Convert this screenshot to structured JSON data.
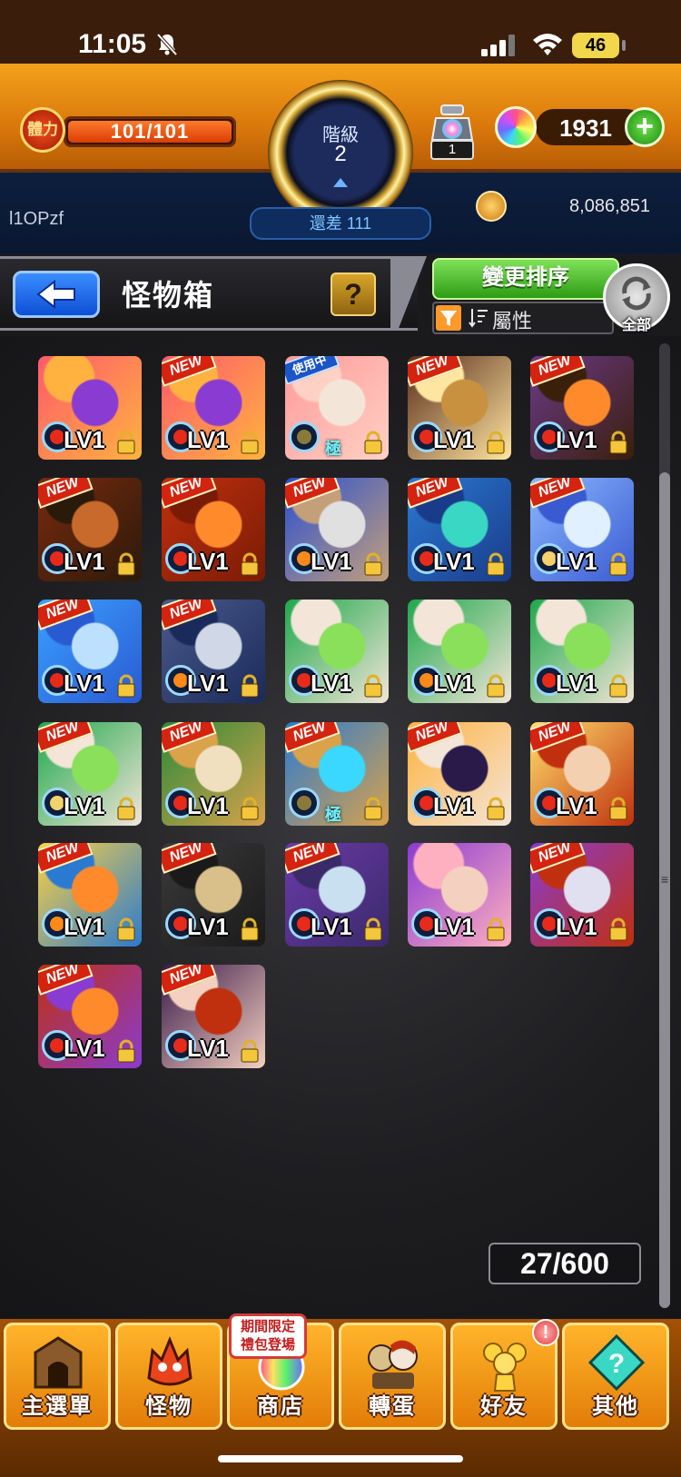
{
  "status_bar": {
    "time": "11:05",
    "battery": "46",
    "icons": [
      "bell-slash-icon",
      "signal-icon",
      "wifi-icon",
      "battery-icon"
    ]
  },
  "hud": {
    "stamina_label": "體力",
    "stamina_value": "101/101",
    "rank_label": "階級",
    "rank_value": "2",
    "rank_remaining": "還差 111",
    "potion_count": "1",
    "orb_count": "1931",
    "plus_label": "+",
    "username": "l1OPzf",
    "gold": "8,086,851"
  },
  "header": {
    "title": "怪物箱",
    "help_label": "?",
    "sort_button": "變更排序",
    "sort_attribute": "屬性",
    "all_label": "全部"
  },
  "monsters": [
    {
      "badge": "",
      "lv": "LV1",
      "element": "fire",
      "art": [
        "#ff5a6b",
        "#8a3bd1",
        "#ffb23f"
      ]
    },
    {
      "badge": "NEW",
      "lv": "LV1",
      "element": "fire",
      "art": [
        "#ff5a6b",
        "#8a3bd1",
        "#ffb23f"
      ]
    },
    {
      "badge": "使用中",
      "lv": "",
      "element": "dark",
      "art": [
        "#ff9a9a",
        "#f3e5d8",
        "#ffd0c4"
      ],
      "tag": "極"
    },
    {
      "badge": "NEW",
      "lv": "LV1",
      "element": "fire",
      "art": [
        "#5a2d1c",
        "#c8913f",
        "#ffe6a0"
      ]
    },
    {
      "badge": "NEW",
      "lv": "LV1",
      "element": "fire",
      "art": [
        "#6b3a8a",
        "#ff8a2b",
        "#3a1f0a"
      ]
    },
    {
      "badge": "NEW",
      "lv": "LV1",
      "element": "fire",
      "art": [
        "#7a2a0e",
        "#c86a2b",
        "#2a1a0a"
      ]
    },
    {
      "badge": "NEW",
      "lv": "LV1",
      "element": "fire",
      "art": [
        "#c0300e",
        "#ff8a2b",
        "#7a1b05"
      ]
    },
    {
      "badge": "NEW",
      "lv": "LV1",
      "element": "flame",
      "art": [
        "#2a4fd1",
        "#e0e0e0",
        "#c4a07a"
      ]
    },
    {
      "badge": "NEW",
      "lv": "LV1",
      "element": "fire",
      "art": [
        "#2a7ad1",
        "#3ad7c4",
        "#1a3b8a"
      ]
    },
    {
      "badge": "NEW",
      "lv": "LV1",
      "element": "light",
      "art": [
        "#8ab8ff",
        "#e0f0ff",
        "#3a5ad1"
      ]
    },
    {
      "badge": "NEW",
      "lv": "LV1",
      "element": "fire",
      "art": [
        "#3aa0ff",
        "#bde0ff",
        "#2a5ad1"
      ]
    },
    {
      "badge": "NEW",
      "lv": "LV1",
      "element": "flame",
      "art": [
        "#4a5a8a",
        "#d0d8e8",
        "#1a2a5a"
      ]
    },
    {
      "badge": "",
      "lv": "LV1",
      "element": "fire",
      "art": [
        "#1ea84b",
        "#8ae05a",
        "#f3e5d8"
      ]
    },
    {
      "badge": "",
      "lv": "LV1",
      "element": "flame",
      "art": [
        "#1ea84b",
        "#8ae05a",
        "#f3e5d8"
      ]
    },
    {
      "badge": "",
      "lv": "LV1",
      "element": "fire",
      "art": [
        "#1ea84b",
        "#8ae05a",
        "#f3e5d8"
      ]
    },
    {
      "badge": "NEW",
      "lv": "LV1",
      "element": "light",
      "art": [
        "#1ea84b",
        "#8ae05a",
        "#f3e5d8"
      ]
    },
    {
      "badge": "NEW",
      "lv": "LV1",
      "element": "fire",
      "art": [
        "#2a8a3a",
        "#f0e0c0",
        "#d9a24b"
      ]
    },
    {
      "badge": "NEW",
      "lv": "",
      "element": "dark",
      "art": [
        "#2a7ad1",
        "#3ad7ff",
        "#d9a24b"
      ],
      "tag": "極"
    },
    {
      "badge": "NEW",
      "lv": "LV1",
      "element": "fire",
      "art": [
        "#ffb23f",
        "#2a1a4a",
        "#f3e5d8"
      ]
    },
    {
      "badge": "NEW",
      "lv": "LV1",
      "element": "fire",
      "art": [
        "#ffe06b",
        "#f3d0b0",
        "#c0300e"
      ]
    },
    {
      "badge": "NEW",
      "lv": "LV1",
      "element": "flame",
      "art": [
        "#ffd23f",
        "#ff8a2b",
        "#2a7ad1"
      ]
    },
    {
      "badge": "NEW",
      "lv": "LV1",
      "element": "fire",
      "art": [
        "#3a3a3a",
        "#d9c08a",
        "#1a1a1a"
      ]
    },
    {
      "badge": "NEW",
      "lv": "LV1",
      "element": "fire",
      "art": [
        "#6b3aa8",
        "#c8e0f0",
        "#3a2a6a"
      ]
    },
    {
      "badge": "",
      "lv": "LV1",
      "element": "fire",
      "art": [
        "#8a3bd1",
        "#f3d0c0",
        "#ffb0c0"
      ]
    },
    {
      "badge": "NEW",
      "lv": "LV1",
      "element": "fire",
      "art": [
        "#8a3bd1",
        "#e0e0f0",
        "#c0300e"
      ]
    },
    {
      "badge": "NEW",
      "lv": "LV1",
      "element": "fire",
      "art": [
        "#c0300e",
        "#ff8a2b",
        "#8a3bd1"
      ]
    },
    {
      "badge": "NEW",
      "lv": "LV1",
      "element": "fire",
      "art": [
        "#3a1a4a",
        "#c0300e",
        "#f3d0c0"
      ]
    }
  ],
  "box_count": "27/600",
  "nav": {
    "home": "主選單",
    "monster": "怪物",
    "shop": "商店",
    "gacha": "轉蛋",
    "friends": "好友",
    "other": "其他",
    "promo_line1": "期間限定",
    "promo_line2": "禮包登場",
    "friends_alert": "!"
  },
  "colors": {
    "accent_orange": "#e27d08",
    "hud_blue": "#0d1f3e",
    "new_badge": "#d4230f",
    "sort_green": "#2e9c14"
  }
}
